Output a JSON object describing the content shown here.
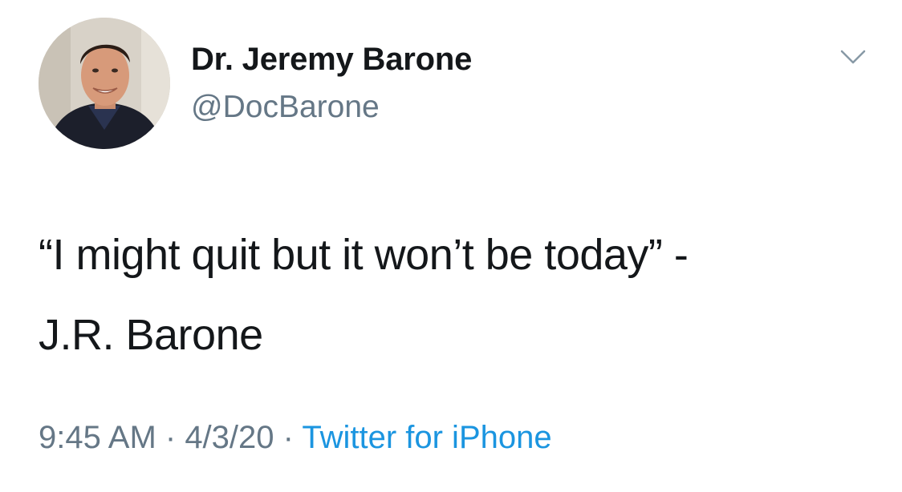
{
  "user": {
    "display_name": "Dr. Jeremy Barone",
    "handle": "@DocBarone"
  },
  "tweet": {
    "text_line1": "“I might quit but it won’t be today” -",
    "text_line2": "J.R. Barone"
  },
  "meta": {
    "time": "9:45 AM",
    "separator1": " · ",
    "date": "4/3/20",
    "separator2": " · ",
    "source": "Twitter for iPhone"
  },
  "colors": {
    "text": "#14171a",
    "secondary": "#657786",
    "link": "#1b95e0",
    "chevron": "#8899a6"
  },
  "icons": {
    "menu": "chevron-down-icon"
  }
}
